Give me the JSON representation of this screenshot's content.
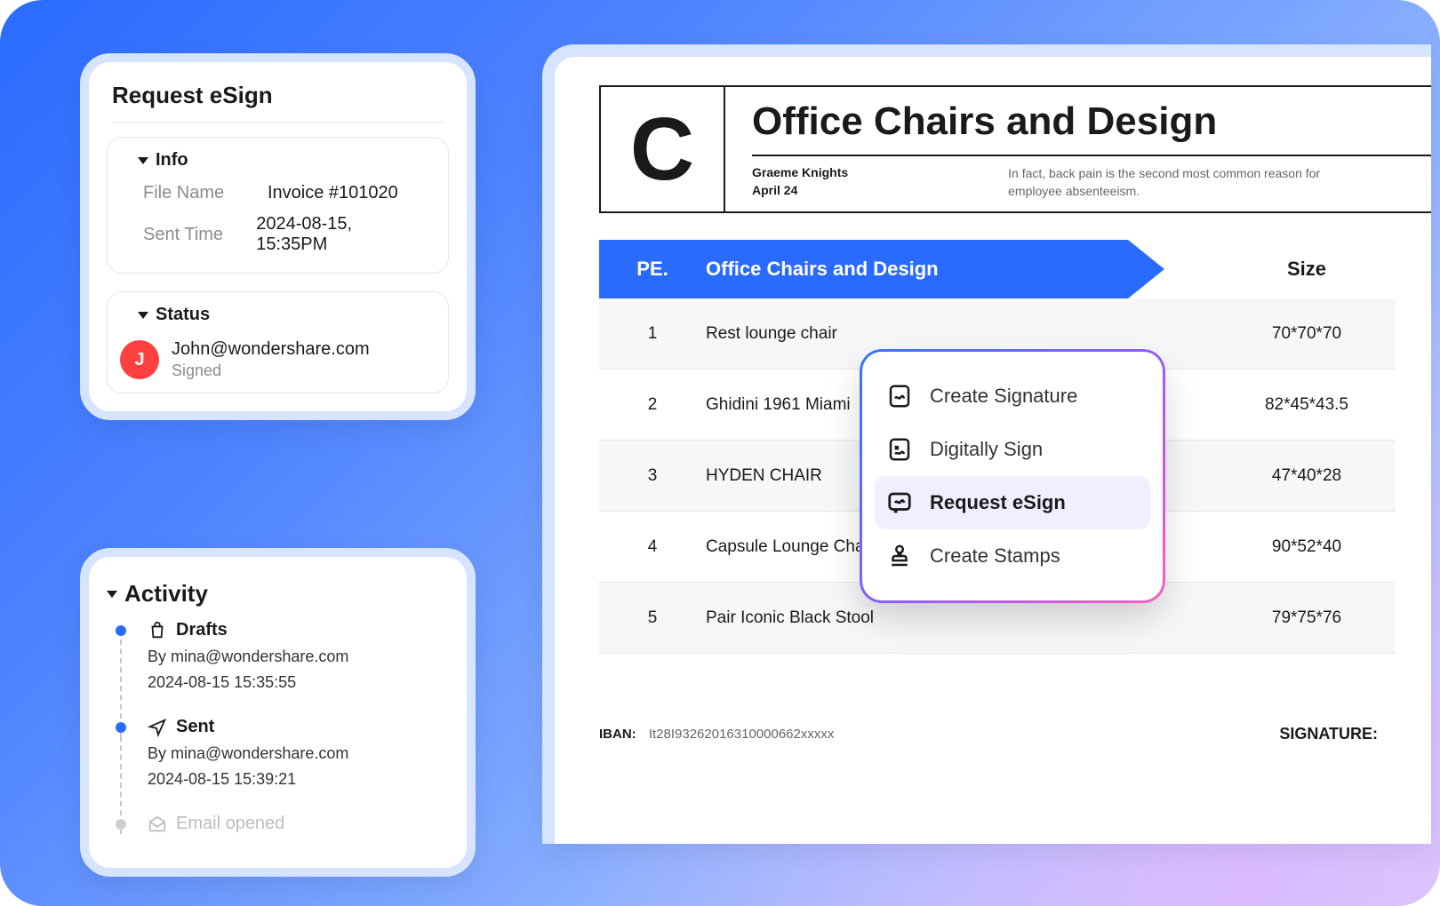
{
  "esign_panel": {
    "title": "Request eSign",
    "info_header": "Info",
    "file_name_label": "File Name",
    "file_name_value": "Invoice #101020",
    "sent_time_label": "Sent Time",
    "sent_time_value": "2024-08-15, 15:35PM",
    "status_header": "Status",
    "avatar_initial": "J",
    "status_email": "John@wondershare.com",
    "status_state": "Signed"
  },
  "activity_panel": {
    "title": "Activity",
    "items": [
      {
        "label": "Drafts",
        "by": "By mina@wondershare.com",
        "date": "2024-08-15 15:35:55"
      },
      {
        "label": "Sent",
        "by": "By mina@wondershare.com",
        "date": "2024-08-15 15:39:21"
      },
      {
        "label": "Email opened",
        "by": "",
        "date": ""
      }
    ]
  },
  "document": {
    "logo_letter": "C",
    "title": "Office Chairs and Design",
    "author": "Graeme Knights",
    "date": "April 24",
    "blurb": "In fact, back pain is the second most common reason for employee absenteeism.",
    "columns": {
      "pe": "PE.",
      "desc": "Office Chairs and Design",
      "size": "Size"
    },
    "rows": [
      {
        "pe": "1",
        "desc": "Rest lounge chair",
        "size": "70*70*70"
      },
      {
        "pe": "2",
        "desc": "Ghidini 1961 Miami",
        "size": "82*45*43.5"
      },
      {
        "pe": "3",
        "desc": "HYDEN CHAIR",
        "size": "47*40*28"
      },
      {
        "pe": "4",
        "desc": "Capsule Lounge Chair",
        "size": "90*52*40"
      },
      {
        "pe": "5",
        "desc": "Pair Iconic Black Stool",
        "size": "79*75*76"
      }
    ],
    "iban_label": "IBAN:",
    "iban_value": "It28I93262016310000662xxxxx",
    "signature_label": "SIGNATURE:"
  },
  "context_menu": {
    "items": [
      {
        "label": "Create Signature"
      },
      {
        "label": "Digitally Sign"
      },
      {
        "label": "Request eSign"
      },
      {
        "label": "Create Stamps"
      }
    ],
    "selected_index": 2
  }
}
